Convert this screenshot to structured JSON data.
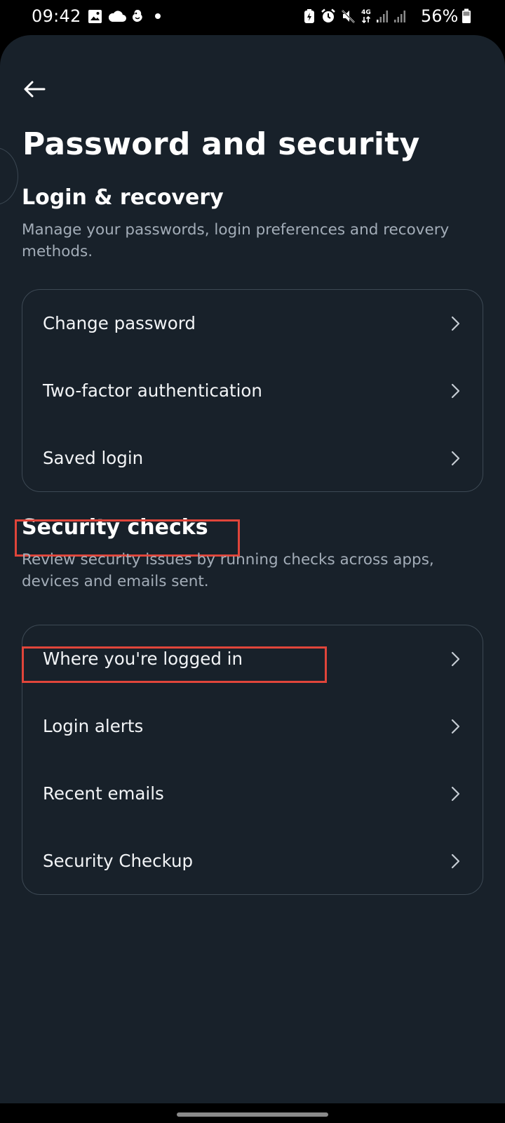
{
  "status_bar": {
    "time": "09:42",
    "battery_percent": "56%",
    "network_label": "4G",
    "icons": [
      "gallery-icon",
      "cloud-icon",
      "app-notification-icon",
      "dot-icon",
      "battery-saver-icon",
      "alarm-icon",
      "mute-icon",
      "network-4g-icon",
      "signal-icon",
      "signal-icon",
      "battery-icon"
    ]
  },
  "header": {
    "back_icon": "back-arrow-icon",
    "title": "Password and security"
  },
  "login_recovery": {
    "title": "Login & recovery",
    "description": "Manage your passwords, login preferences and recovery methods.",
    "items": [
      {
        "label": "Change password",
        "icon": "chevron-right-icon"
      },
      {
        "label": "Two-factor authentication",
        "icon": "chevron-right-icon"
      },
      {
        "label": "Saved login",
        "icon": "chevron-right-icon"
      }
    ]
  },
  "security_checks": {
    "title": "Security checks",
    "description": "Review security issues by running checks across apps, devices and emails sent.",
    "items": [
      {
        "label": "Where you're logged in",
        "icon": "chevron-right-icon"
      },
      {
        "label": "Login alerts",
        "icon": "chevron-right-icon"
      },
      {
        "label": "Recent emails",
        "icon": "chevron-right-icon"
      },
      {
        "label": "Security Checkup",
        "icon": "chevron-right-icon"
      }
    ]
  },
  "colors": {
    "panel_background": "#18212a",
    "card_border": "#3d4954",
    "secondary_text": "#a3adb8",
    "highlight": "#e0453a"
  }
}
